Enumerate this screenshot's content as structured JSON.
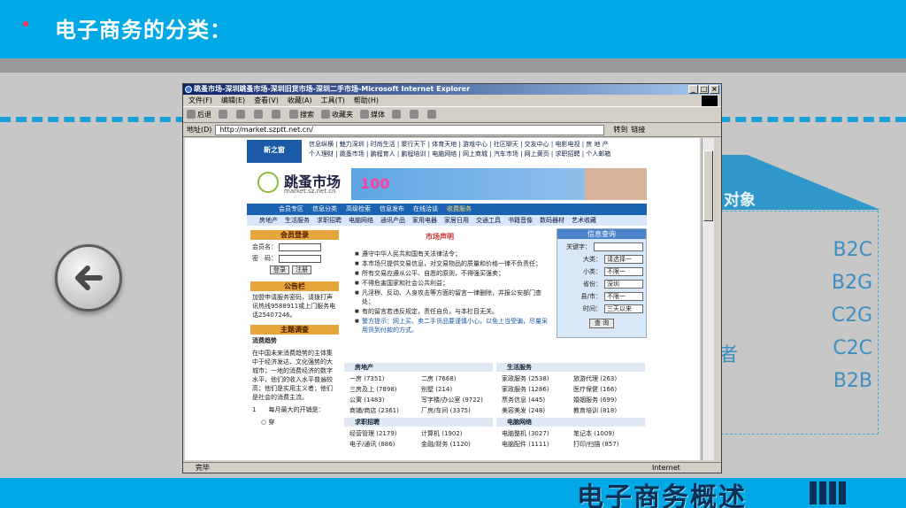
{
  "slide": {
    "title": "电子商务的分类：",
    "bg_label": "对象",
    "bg_items": [
      "B2C",
      "B2G",
      "C2G",
      "C2C",
      "B2B"
    ],
    "bg_side_char": "者",
    "footer_title": "电子商务概述",
    "colors": {
      "header": "#00a9e6",
      "accent": "#ff3355",
      "footer_text": "#0b2f55"
    }
  },
  "back_button": {
    "icon": "back-arrow-icon"
  },
  "browser": {
    "title": "跳蚤市场-深圳跳蚤市场-深圳旧货市场-深圳二手市场-Microsoft Internet Explorer",
    "menu": [
      "文件(F)",
      "编辑(E)",
      "查看(V)",
      "收藏(A)",
      "工具(T)",
      "帮助(H)"
    ],
    "toolbar": [
      "后退",
      "搜索",
      "收藏夹",
      "媒体"
    ],
    "address_label": "地址(D)",
    "address_value": "http://market.szptt.net.cn/",
    "go_label": "转到",
    "links_label": "链接",
    "status_left": "完毕",
    "status_zone": "Internet"
  },
  "page": {
    "site_logo": "新之窗 www.sz.net.cn",
    "site_nav": [
      "信息纵横 | 魅力深圳 | 时尚生活 | 聚行天下 | 体育天地 | 游戏中心 | 社区聊天 | 交友中心 | 电影电视 | 房 地 产",
      "个人理财 | 跳蚤市场 | 鹏程育人 | 鹏程培训 | 电脑网络 | 网上商城 | 汽车市场 | 网上黄页 | 求职招聘 | 个人邮箱"
    ],
    "market_name": "跳蚤市场",
    "market_domain": "market.sz.net.cn",
    "ad_text": "100",
    "blue_nav": [
      "会员专区",
      "信息分类",
      "高级检索",
      "信息发布",
      "在线洽谈",
      "收费服务"
    ],
    "blue_nav_active": "收费服务",
    "sub_nav": [
      "房地产",
      "生活服务",
      "求职招聘",
      "电脑网络",
      "通讯产品",
      "家用电器",
      "家居日用",
      "交通工具",
      "书籍音像",
      "数码器材",
      "艺术收藏"
    ],
    "login": {
      "title": "会员登录",
      "user_label": "会员名：",
      "pwd_label": "密　码：",
      "login_btn": "登录",
      "register_btn": "注册"
    },
    "notice_board": {
      "title": "公告栏",
      "text": "加盟申请服务密码，请拨打声讯热线9588911或上门服务电话25407246。"
    },
    "survey": {
      "title": "主题调查",
      "heading": "消费趋势",
      "text": "在中国未来消费趋势的主体集中于经济发达、文化强势的大城市；一地的消费经济的数字水平，他们的收入水平普遍较高；他们是实用主义者；他们是社会的消费主流。",
      "option": "1　　每月最大的开销是：",
      "radio": "穿"
    },
    "market_notice": {
      "title": "市场声明",
      "items": [
        "遵守中华人民共和国有关法律法令；",
        "本市场只提供交易信息，对交易物品的质量和价格一律不负责任；",
        "所有交易应遵从公平、自愿的原则，不得强买强卖；",
        "不得危害国家和社会公共利益；",
        "凡淫秽、反动、人身攻击等方面的留言一律删除，并报公安部门查处；",
        "有的留言若违反规定，责任自负，与本栏目无关。"
      ],
      "warning": "警方提示：网上买、卖二手货品要谨慎小心，以免上当受骗，尽量采用货到付款的方式。"
    },
    "info_search": {
      "title": "信息查询",
      "keyword_label": "关键字：",
      "rows": [
        {
          "label": "大类：",
          "value": "请选择一"
        },
        {
          "label": "小类：",
          "value": "不限一"
        },
        {
          "label": "省份：",
          "value": "深圳"
        },
        {
          "label": "县/市：",
          "value": "不限一"
        },
        {
          "label": "时间：",
          "value": "三天以来"
        }
      ],
      "button": "查 询"
    },
    "categories": [
      {
        "title": "房地产",
        "items": [
          "一房 (7351)",
          "二房 (7668)",
          "三房及上 (7898)",
          "别墅 (214)",
          "公寓 (1483)",
          "写字楼/办公室 (9722)",
          "商铺/商店 (2361)",
          "厂房/车间 (3375)"
        ]
      },
      {
        "title": "生活服务",
        "items": [
          "家政服务 (2538)",
          "旅游代理 (263)",
          "家政服务 (1286)",
          "医疗保健 (166)",
          "票务信息 (445)",
          "婚姻服务 (699)",
          "美容美发 (248)",
          "教育培训 (818)"
        ]
      },
      {
        "title": "求职招聘",
        "items": [
          "经营管理 (2179)",
          "计算机 (1902)",
          "电子/通讯 (886)",
          "金融/财务 (1120)"
        ]
      },
      {
        "title": "电脑网络",
        "items": [
          "电脑整机 (3027)",
          "笔记本 (1009)",
          "电脑配件 (1111)",
          "打印/扫描 (857)"
        ]
      }
    ]
  }
}
